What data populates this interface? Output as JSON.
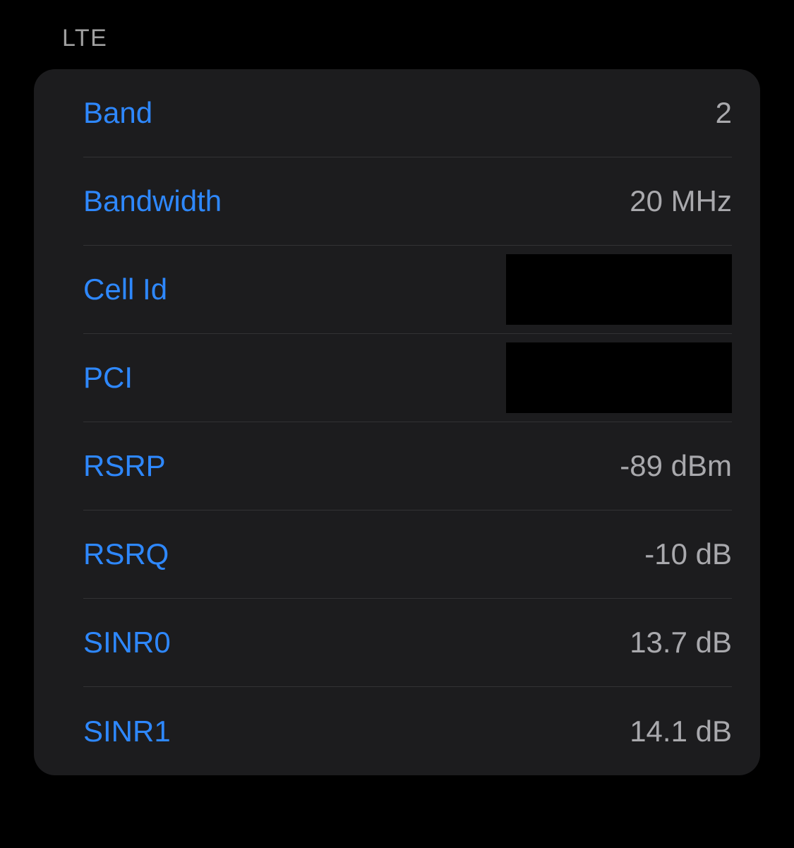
{
  "section": {
    "title": "LTE"
  },
  "rows": {
    "band": {
      "label": "Band",
      "value": "2"
    },
    "bandwidth": {
      "label": "Bandwidth",
      "value": "20 MHz"
    },
    "cell_id": {
      "label": "Cell Id",
      "value": ""
    },
    "pci": {
      "label": "PCI",
      "value": ""
    },
    "rsrp": {
      "label": "RSRP",
      "value": "-89 dBm"
    },
    "rsrq": {
      "label": "RSRQ",
      "value": "-10 dB"
    },
    "sinr0": {
      "label": "SINR0",
      "value": "13.7 dB"
    },
    "sinr1": {
      "label": "SINR1",
      "value": "14.1 dB"
    }
  }
}
